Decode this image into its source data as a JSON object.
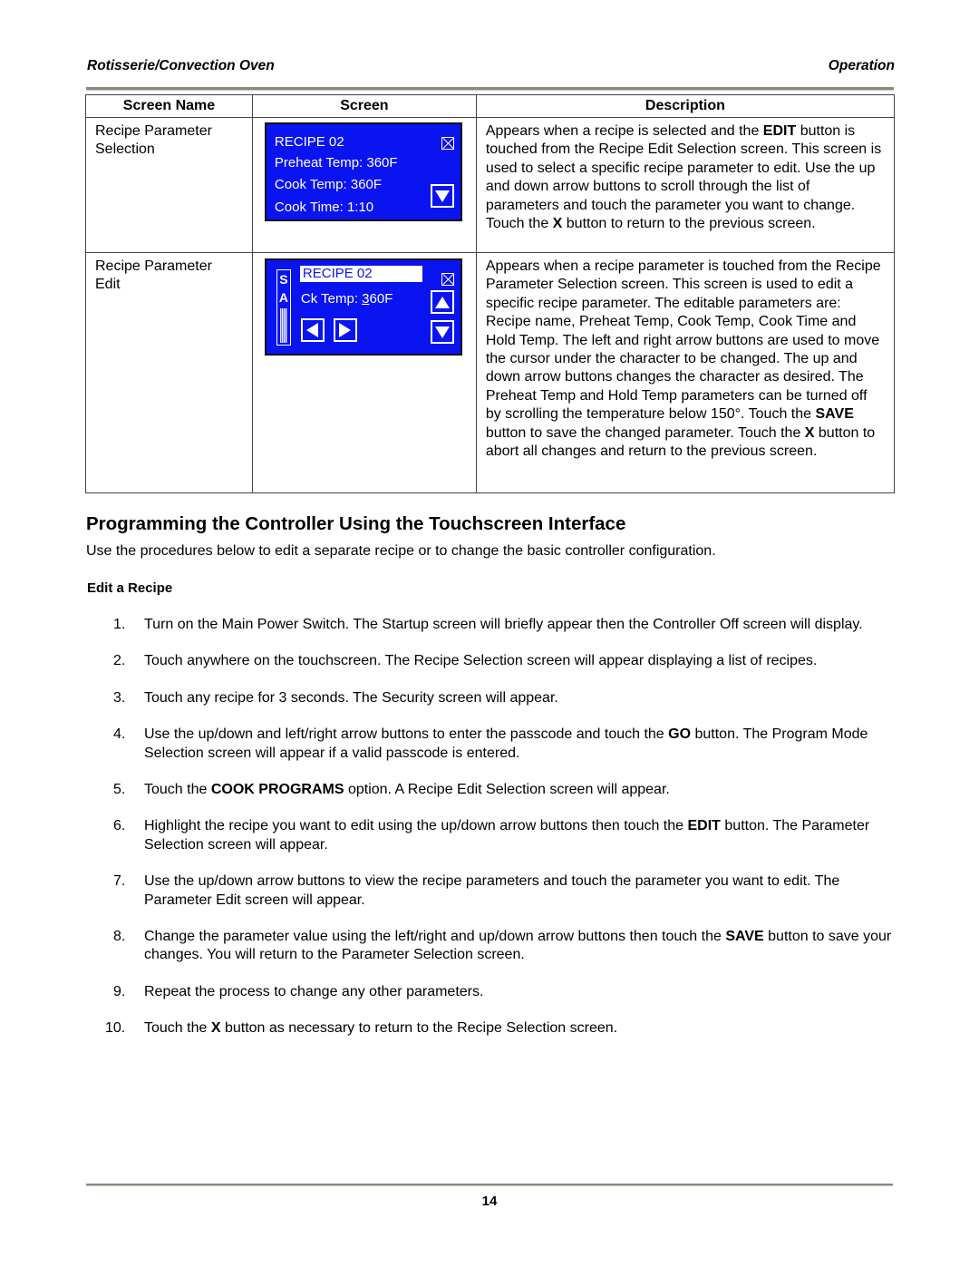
{
  "header": {
    "left": "Rotisserie/Convection Oven",
    "right": "Operation"
  },
  "table": {
    "columns": [
      "Screen Name",
      "Screen",
      "Description"
    ],
    "rows": [
      {
        "name": "Recipe Parameter Selection",
        "screen": {
          "title": "RECIPE 02",
          "lines": [
            "Preheat Temp: 360F",
            "Cook Temp: 360F",
            "Cook Time: 1:10"
          ],
          "icons": [
            "close-x-icon",
            "arrow-down-icon"
          ]
        },
        "description_parts": [
          {
            "text": "Appears when a recipe is selected and the "
          },
          {
            "text": "EDIT",
            "bold": true
          },
          {
            "text": " button is touched from the Recipe Edit Selection screen. This screen is used to select a specific recipe parameter to edit. Use the up and down arrow buttons to scroll through the list of parameters and touch the parameter you want to change. Touch the "
          },
          {
            "text": "X",
            "bold": true
          },
          {
            "text": " button to return to the previous screen."
          }
        ]
      },
      {
        "name": "Recipe Parameter Edit",
        "screen": {
          "title": "RECIPE 02",
          "save_strip": [
            "S",
            "A"
          ],
          "param_label": "Ck Temp: ",
          "param_cursor_char": "3",
          "param_rest": "60F",
          "icons": [
            "close-x-icon",
            "arrow-up-icon",
            "arrow-down-icon",
            "arrow-left-icon",
            "arrow-right-icon"
          ]
        },
        "description_parts": [
          {
            "text": "Appears when a recipe parameter is touched from the Recipe Parameter Selection screen. This screen is used to edit a specific recipe parameter. The editable parameters are: Recipe name, Preheat Temp, Cook Temp, Cook Time and Hold Temp. The left and right arrow buttons are used to move the cursor under the character to be changed. The up and down arrow buttons changes the character as desired. The Preheat Temp and Hold Temp parameters can be turned off by scrolling the temperature below 150°. Touch the "
          },
          {
            "text": "SAVE",
            "bold": true
          },
          {
            "text": " button to save the changed parameter. Touch the "
          },
          {
            "text": "X",
            "bold": true
          },
          {
            "text": " button to abort all changes and return to the previous screen."
          }
        ]
      }
    ]
  },
  "section": {
    "title": "Programming the Controller Using the Touchscreen Interface",
    "intro": "Use the procedures below to edit a separate recipe or to change the basic controller configuration.",
    "subtitle": "Edit a Recipe",
    "steps": [
      {
        "num": "1.",
        "parts": [
          {
            "text": "Turn on the Main Power Switch. The Startup screen will briefly appear then the Controller Off screen will display."
          }
        ]
      },
      {
        "num": "2.",
        "parts": [
          {
            "text": "Touch anywhere on the touchscreen. The Recipe Selection screen will appear displaying a list of recipes."
          }
        ]
      },
      {
        "num": "3.",
        "parts": [
          {
            "text": "Touch any recipe for 3 seconds. The Security screen will appear."
          }
        ]
      },
      {
        "num": "4.",
        "parts": [
          {
            "text": "Use the up/down and left/right arrow buttons to enter the passcode and touch the "
          },
          {
            "text": "GO",
            "bold": true
          },
          {
            "text": " button. The Program Mode Selection screen will appear if a valid passcode is entered."
          }
        ]
      },
      {
        "num": "5.",
        "parts": [
          {
            "text": "Touch the "
          },
          {
            "text": "COOK PROGRAMS",
            "bold": true
          },
          {
            "text": " option. A Recipe Edit Selection screen will appear."
          }
        ]
      },
      {
        "num": "6.",
        "parts": [
          {
            "text": "Highlight the recipe you want to edit using the up/down arrow buttons then touch the "
          },
          {
            "text": "EDIT",
            "bold": true
          },
          {
            "text": " button. The Parameter Selection screen will appear."
          }
        ]
      },
      {
        "num": "7.",
        "parts": [
          {
            "text": "Use the up/down arrow buttons to view the recipe parameters and touch the parameter you want to edit. The Parameter Edit screen will appear."
          }
        ]
      },
      {
        "num": "8.",
        "parts": [
          {
            "text": "Change the parameter value using the left/right and up/down arrow buttons then touch the "
          },
          {
            "text": "SAVE",
            "bold": true
          },
          {
            "text": " button to save your changes. You will return to the Parameter Selection screen."
          }
        ]
      },
      {
        "num": "9.",
        "parts": [
          {
            "text": "Repeat the process to change any other parameters."
          }
        ]
      },
      {
        "num": "10.",
        "parts": [
          {
            "text": "Touch the "
          },
          {
            "text": "X",
            "bold": true
          },
          {
            "text": " button as necessary to return to the Recipe Selection screen."
          }
        ]
      }
    ]
  },
  "footer": {
    "page_number": "14"
  },
  "colors": {
    "lcd_background": "#0a14f0",
    "lcd_text": "#ffffff",
    "rule": "#8a8a7a"
  }
}
